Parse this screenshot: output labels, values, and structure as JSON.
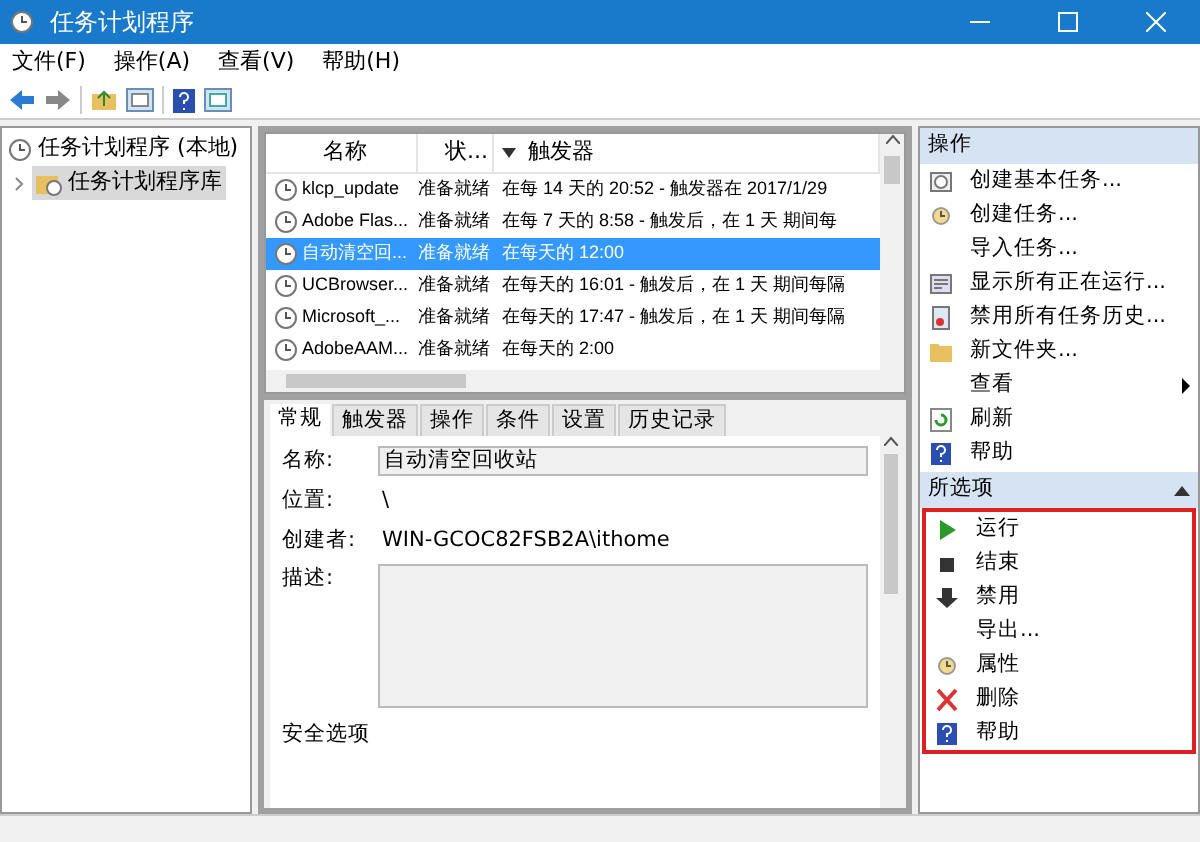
{
  "window": {
    "title": "任务计划程序"
  },
  "menu": [
    "文件(F)",
    "操作(A)",
    "查看(V)",
    "帮助(H)"
  ],
  "tree": [
    {
      "label": "任务计划程序 (本地)",
      "expanded": true,
      "children": [
        {
          "label": "任务计划程序库",
          "selected": true
        }
      ]
    }
  ],
  "table": {
    "columns": [
      "名称",
      "状...",
      "触发器"
    ],
    "rows": [
      {
        "cells": [
          "klcp_update",
          "准备就绪",
          "在每 14 天的 20:52 - 触发器在 2017/1/29"
        ],
        "selected": false
      },
      {
        "cells": [
          "Adobe Flas...",
          "准备就绪",
          "在每 7 天的 8:58 - 触发后，在 1 天 期间每"
        ],
        "selected": false
      },
      {
        "cells": [
          "自动清空回...",
          "准备就绪",
          "在每天的 12:00"
        ],
        "selected": true
      },
      {
        "cells": [
          "UCBrowser...",
          "准备就绪",
          "在每天的 16:01 - 触发后，在 1 天 期间每隔"
        ],
        "selected": false
      },
      {
        "cells": [
          "Microsoft_...",
          "准备就绪",
          "在每天的 17:47 - 触发后，在 1 天 期间每隔"
        ],
        "selected": false
      },
      {
        "cells": [
          "AdobeAAM...",
          "准备就绪",
          "在每天的 2:00"
        ],
        "selected": false
      }
    ]
  },
  "details": {
    "tabs": [
      {
        "label": "常规",
        "selected": true
      },
      {
        "label": "触发器",
        "selected": false
      },
      {
        "label": "操作",
        "selected": false
      },
      {
        "label": "条件",
        "selected": false
      },
      {
        "label": "设置",
        "selected": false
      },
      {
        "label": "历史记录",
        "selected": false
      }
    ],
    "fields": [
      {
        "kind": "field",
        "label": "名称:",
        "value": "自动清空回收站"
      },
      {
        "kind": "text",
        "label": "位置:",
        "value": "\\"
      },
      {
        "kind": "text",
        "label": "创建者:",
        "value": "WIN-GCOC82FSB2A\\ithome"
      },
      {
        "kind": "area",
        "label": "描述:"
      }
    ],
    "section": "安全选项"
  },
  "actions": {
    "title": "操作",
    "items": [
      {
        "kind": "task",
        "label": "创建基本任务..."
      },
      {
        "kind": "clock",
        "label": "创建任务..."
      },
      {
        "kind": "plain",
        "label": "导入任务..."
      },
      {
        "kind": "list",
        "label": "显示所有正在运行..."
      },
      {
        "kind": "history",
        "label": "禁用所有任务历史..."
      },
      {
        "kind": "folder",
        "label": "新文件夹..."
      },
      {
        "kind": "plain",
        "label": "查看",
        "submenu": true
      },
      {
        "kind": "refresh",
        "label": "刷新"
      },
      {
        "kind": "help",
        "label": "帮助"
      }
    ]
  },
  "selected_actions": {
    "title": "所选项",
    "items": [
      {
        "kind": "run",
        "label": "运行"
      },
      {
        "kind": "stop",
        "label": "结束"
      },
      {
        "kind": "disable",
        "label": "禁用"
      },
      {
        "kind": "plain",
        "label": "导出..."
      },
      {
        "kind": "clock",
        "label": "属性"
      },
      {
        "kind": "delete",
        "label": "删除"
      },
      {
        "kind": "help",
        "label": "帮助"
      }
    ]
  }
}
